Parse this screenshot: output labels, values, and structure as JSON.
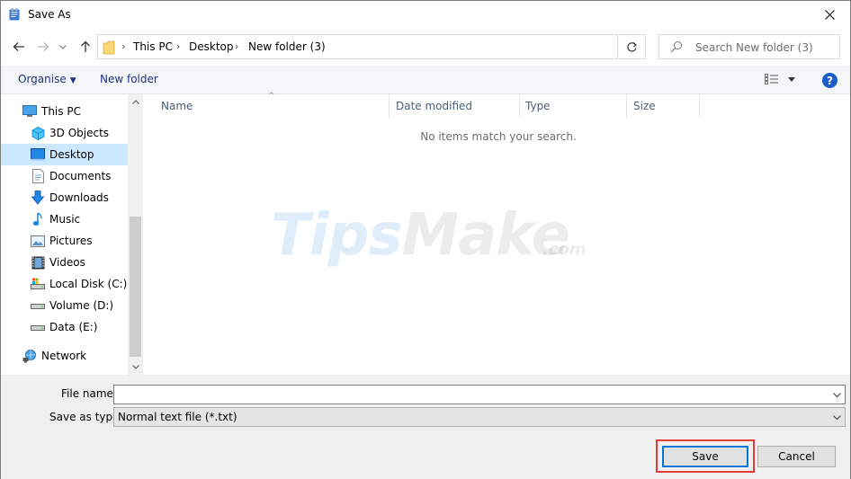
{
  "window": {
    "title": "Save As"
  },
  "address": {
    "crumbs": [
      "This PC",
      "Desktop",
      "New folder (3)"
    ],
    "search_placeholder": "Search New folder (3)"
  },
  "commands": {
    "organise": "Organise",
    "new_folder": "New folder",
    "help": "?"
  },
  "nav": {
    "items": [
      {
        "label": "This PC",
        "icon": "computer-icon"
      },
      {
        "label": "3D Objects",
        "icon": "cube-icon"
      },
      {
        "label": "Desktop",
        "icon": "desktop-icon",
        "selected": true
      },
      {
        "label": "Documents",
        "icon": "document-icon"
      },
      {
        "label": "Downloads",
        "icon": "download-arrow-icon"
      },
      {
        "label": "Music",
        "icon": "music-note-icon"
      },
      {
        "label": "Pictures",
        "icon": "picture-icon"
      },
      {
        "label": "Videos",
        "icon": "film-icon"
      },
      {
        "label": "Local Disk (C:)",
        "icon": "system-drive-icon"
      },
      {
        "label": "Volume (D:)",
        "icon": "drive-icon"
      },
      {
        "label": "Data (E:)",
        "icon": "drive-icon"
      },
      {
        "label": "Network",
        "icon": "network-icon"
      }
    ]
  },
  "files": {
    "columns": [
      "Name",
      "Date modified",
      "Type",
      "Size"
    ],
    "empty_message": "No items match your search."
  },
  "watermark": {
    "part1": "Tips",
    "part2": "Make",
    "domain": ".com"
  },
  "form": {
    "filename_label": "File name:",
    "filename_value": "",
    "savetype_label": "Save as type:",
    "savetype_value": "Normal text file (*.txt)"
  },
  "buttons": {
    "save": "Save",
    "cancel": "Cancel"
  },
  "colors": {
    "accent": "#0078d7",
    "selected_bg": "#cce8ff",
    "highlight": "#e53935",
    "link": "#1e3287"
  }
}
